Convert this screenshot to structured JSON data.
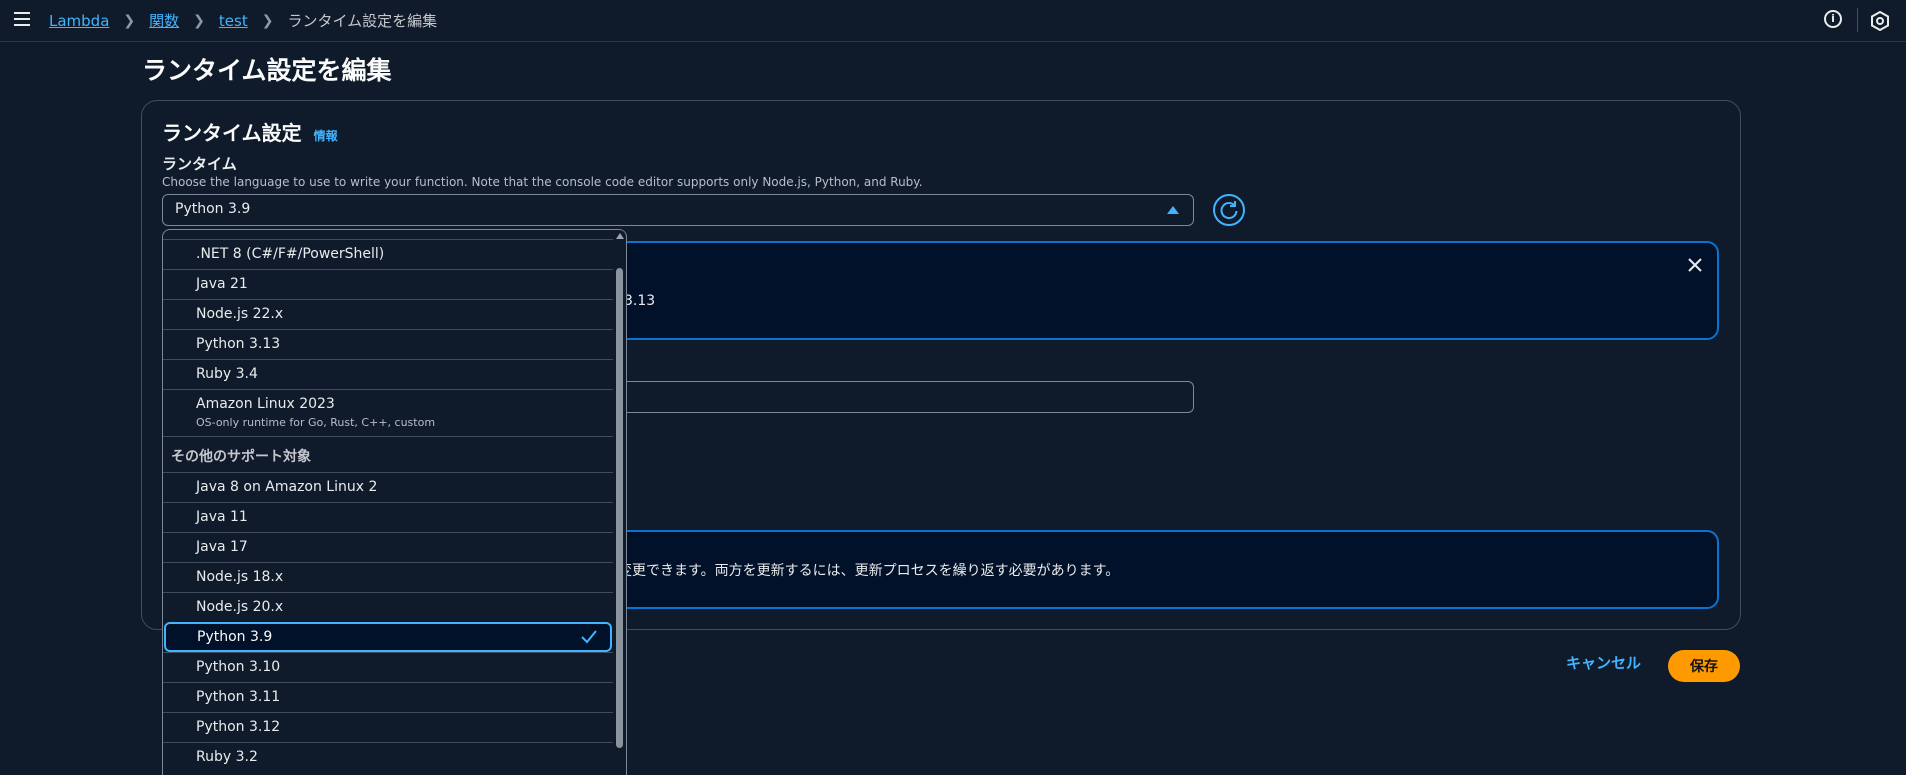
{
  "breadcrumbs": {
    "items": [
      "Lambda",
      "関数",
      "test"
    ],
    "current": "ランタイム設定を編集"
  },
  "page": {
    "title": "ランタイム設定を編集"
  },
  "container": {
    "title": "ランタイム設定",
    "info_label": "情報"
  },
  "runtime_field": {
    "label": "ランタイム",
    "description": "Choose the language to use to write your function. Note that the console code editor supports only Node.js, Python, and Ruby.",
    "selected": "Python 3.9"
  },
  "alert1": {
    "partial_text": "3.13"
  },
  "alert2": {
    "partial_text": "変更できます。両方を更新するには、更新プロセスを繰り返す必要があります。"
  },
  "actions": {
    "cancel": "キャンセル",
    "save": "保存"
  },
  "dropdown": {
    "latest": [
      ".NET 8 (C#/F#/PowerShell)",
      "Java 21",
      "Node.js 22.x",
      "Python 3.13",
      "Ruby 3.4"
    ],
    "amazon_linux": {
      "label": "Amazon Linux 2023",
      "description": "OS-only runtime for Go, Rust, C++, custom"
    },
    "group_label": "その他のサポート対象",
    "other": [
      "Java 8 on Amazon Linux 2",
      "Java 11",
      "Java 17",
      "Node.js 18.x",
      "Node.js 20.x",
      "Python 3.9",
      "Python 3.10",
      "Python 3.11",
      "Python 3.12",
      "Ruby 3.2"
    ],
    "selected_index": 5
  },
  "colors": {
    "accent": "#42b4ff",
    "primary_button": "#ff9900",
    "background": "#0f1b2a"
  },
  "icons": {
    "menu": "hamburger-icon",
    "info": "info-icon",
    "notifications": "hexagon-icon",
    "refresh": "refresh-icon",
    "close": "close-icon",
    "selected": "check-icon"
  }
}
